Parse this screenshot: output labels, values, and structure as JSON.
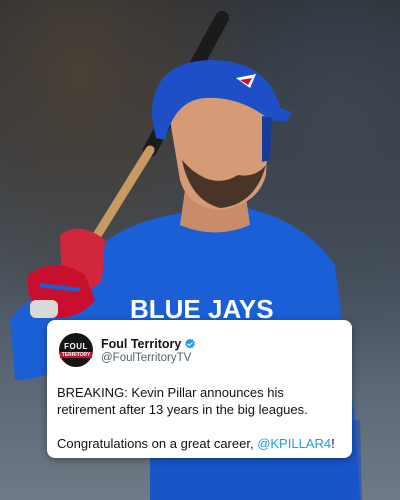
{
  "tweet": {
    "display_name": "Foul Territory",
    "handle": "@FoulTerritoryTV",
    "avatar_line1": "FOUL",
    "avatar_line2": "TERRITORY",
    "paragraph1": "BREAKING: Kevin Pillar announces his retirement after 13 years in the big leagues.",
    "paragraph2_prefix": "Congratulations on a great career, ",
    "paragraph2_mention": "@KPILLAR4",
    "paragraph2_suffix": "!",
    "verified_icon": "verified-badge-icon",
    "verified_color": "#1d9bf0",
    "mention_color": "#1d9bf0"
  },
  "photo": {
    "jersey_text": "BLUE JAYS",
    "jersey_color": "#1a5fd6",
    "helmet_color": "#1e4fc7"
  }
}
